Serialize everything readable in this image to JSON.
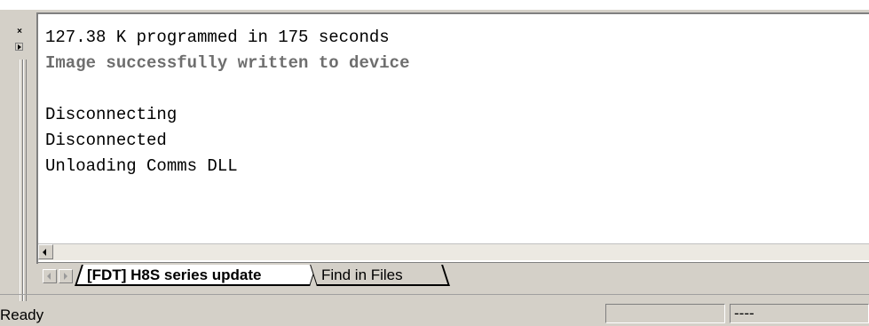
{
  "output": {
    "lines": [
      {
        "text": "127.38 K programmed in 175 seconds",
        "style": "normal"
      },
      {
        "text": "Image successfully written to device",
        "style": "highlight"
      },
      {
        "text": "",
        "style": "normal"
      },
      {
        "text": "Disconnecting",
        "style": "normal"
      },
      {
        "text": "Disconnected",
        "style": "normal"
      },
      {
        "text": "Unloading Comms DLL",
        "style": "normal"
      }
    ]
  },
  "grip": {
    "close_icon": "close-icon",
    "expand_icon": "expand-icon",
    "close_glyph": "×"
  },
  "tabs": [
    {
      "label": "[FDT] H8S series update",
      "active": true
    },
    {
      "label": "Find in Files",
      "active": false
    }
  ],
  "status_bar": {
    "text": "Ready",
    "panel_1": "",
    "panel_2": "----"
  },
  "colors": {
    "background": "#d4d0c8",
    "pane": "#ffffff",
    "highlight_text": "#6e6e6e"
  }
}
